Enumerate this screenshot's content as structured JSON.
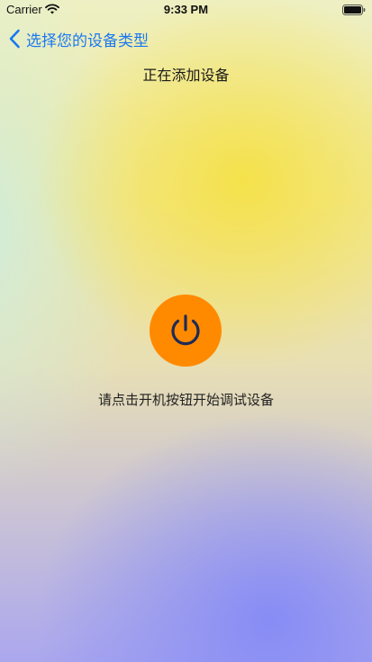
{
  "status_bar": {
    "carrier": "Carrier",
    "time": "9:33 PM",
    "icons": [
      "wifi-icon",
      "battery-icon"
    ]
  },
  "nav": {
    "back_label": "选择您的设备类型",
    "back_icon": "chevron-left-icon",
    "accent_color": "#1a78f0"
  },
  "main": {
    "title": "正在添加设备",
    "power_icon": "power-icon",
    "power_button_color": "#ff8a00",
    "instruction": "请点击开机按钮开始调试设备"
  }
}
